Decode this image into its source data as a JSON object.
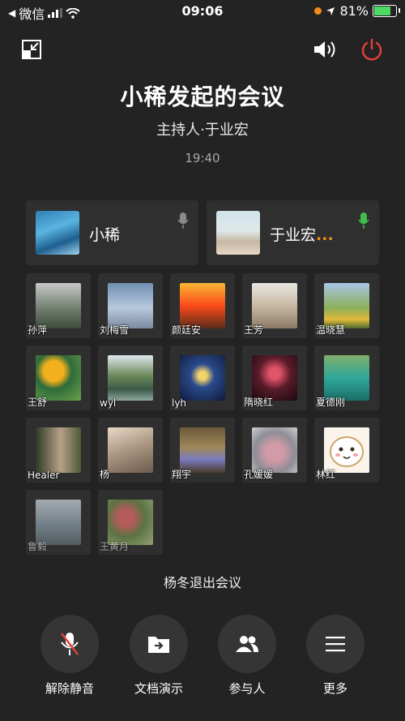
{
  "status_bar": {
    "back_app": "微信",
    "time": "09:06",
    "battery": "81%"
  },
  "meeting": {
    "title": "小稀发起的会议",
    "host": "主持人·于业宏",
    "elapsed": "19:40",
    "notice": "杨冬退出会议"
  },
  "speakers": [
    {
      "name": "小稀",
      "mic": "muted-gray"
    },
    {
      "name": "于业宏",
      "mic": "active-green",
      "suffix": "..."
    }
  ],
  "participants": [
    {
      "name": "孙萍"
    },
    {
      "name": "刘梅雪"
    },
    {
      "name": "颜廷安"
    },
    {
      "name": "王芳"
    },
    {
      "name": "温晓慧"
    },
    {
      "name": "王舒"
    },
    {
      "name": "wyl"
    },
    {
      "name": "lyh"
    },
    {
      "name": "隋晓红"
    },
    {
      "name": "夏德刚"
    },
    {
      "name": "Healer"
    },
    {
      "name": "杨"
    },
    {
      "name": "翔宇"
    },
    {
      "name": "孔媛媛"
    },
    {
      "name": "林红"
    },
    {
      "name": "鲁毅"
    },
    {
      "name": "王黄月"
    }
  ],
  "actions": [
    {
      "label": "解除静音",
      "icon": "mic-muted-icon"
    },
    {
      "label": "文档演示",
      "icon": "folder-share-icon"
    },
    {
      "label": "参与人",
      "icon": "people-icon"
    },
    {
      "label": "更多",
      "icon": "menu-icon"
    }
  ],
  "colors": {
    "background": "#232323",
    "card": "#2f2f2f",
    "power_red": "#e0413a",
    "mic_green": "#3fbf4a",
    "speaking_orange": "#f08c1e"
  }
}
